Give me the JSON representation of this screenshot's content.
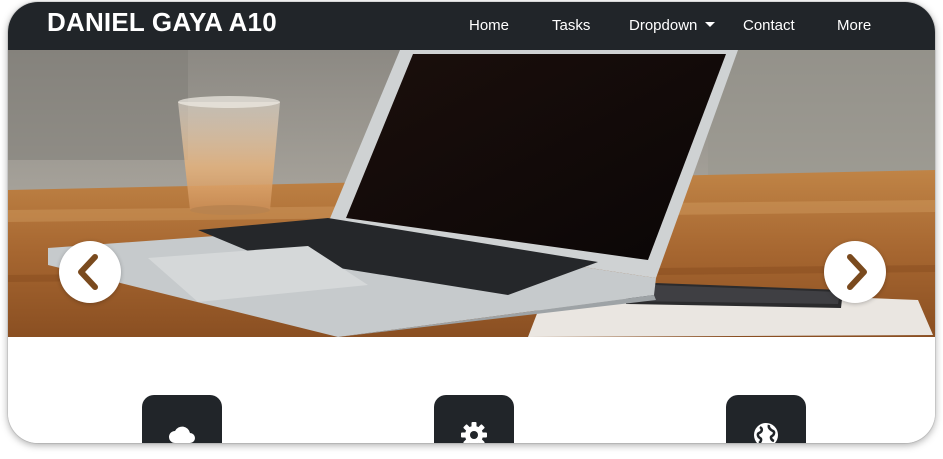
{
  "navbar": {
    "brand": "DANIEL GAYA A10",
    "items": [
      {
        "label": "Home"
      },
      {
        "label": "Tasks"
      },
      {
        "label": "Dropdown",
        "has_caret": true
      },
      {
        "label": "Contact"
      },
      {
        "label": "More"
      }
    ]
  },
  "carousel": {
    "prev_icon": "chevron-left-icon",
    "next_icon": "chevron-right-icon",
    "arrow_color": "#7a4a1e"
  },
  "features": [
    {
      "icon": "cloud-icon"
    },
    {
      "icon": "gear-icon"
    },
    {
      "icon": "globe-icon"
    }
  ],
  "colors": {
    "navbar_bg": "#212529",
    "tile_bg": "#212529"
  }
}
